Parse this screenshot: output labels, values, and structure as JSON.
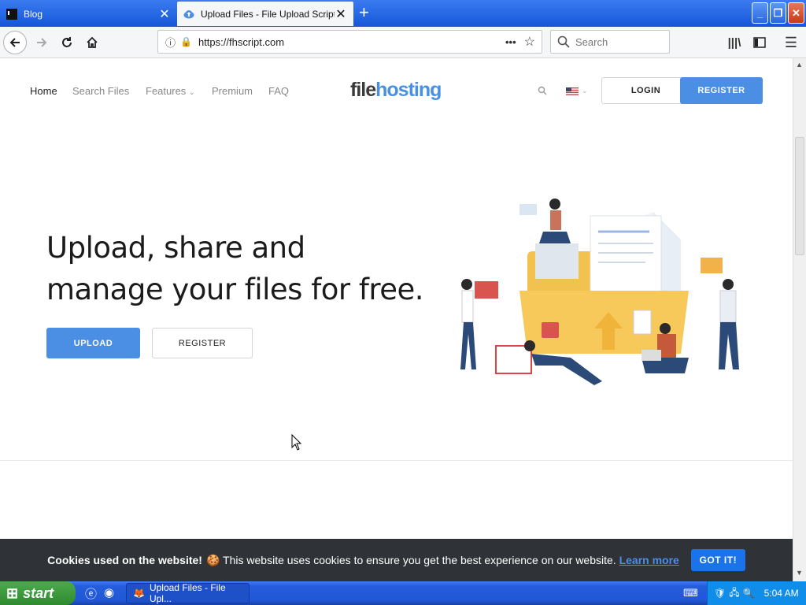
{
  "browser": {
    "tabs": [
      {
        "label": "Blog",
        "close": "✕"
      },
      {
        "label": "Upload Files - File Upload Script",
        "close": "✕"
      }
    ],
    "new_tab": "+",
    "url": "https://fhscript.com",
    "page_actions": "•••",
    "search_placeholder": "Search"
  },
  "site": {
    "nav": [
      "Home",
      "Search Files",
      "Features",
      "Premium",
      "FAQ"
    ],
    "features_caret": "⌄",
    "logo_part1": "file",
    "logo_part2": "hosting",
    "login": "LOGIN",
    "register": "REGISTER"
  },
  "hero": {
    "line1": "Upload, share and",
    "line2": "manage your files for free.",
    "upload": "UPLOAD",
    "register": "REGISTER"
  },
  "cookie": {
    "bold": "Cookies used on the website!",
    "emoji": "🍪",
    "text": " This website uses cookies to ensure you get the best experience on our website. ",
    "link": "Learn more",
    "button": "GOT IT!"
  },
  "taskbar": {
    "start": "start",
    "task": "Upload Files - File Upl...",
    "time": "5:04 AM"
  },
  "colors": {
    "accent": "#4a8fe3",
    "logo_dark": "#3a3a3a",
    "logo_blue": "#4a90e2",
    "folder": "#f6c95a"
  }
}
